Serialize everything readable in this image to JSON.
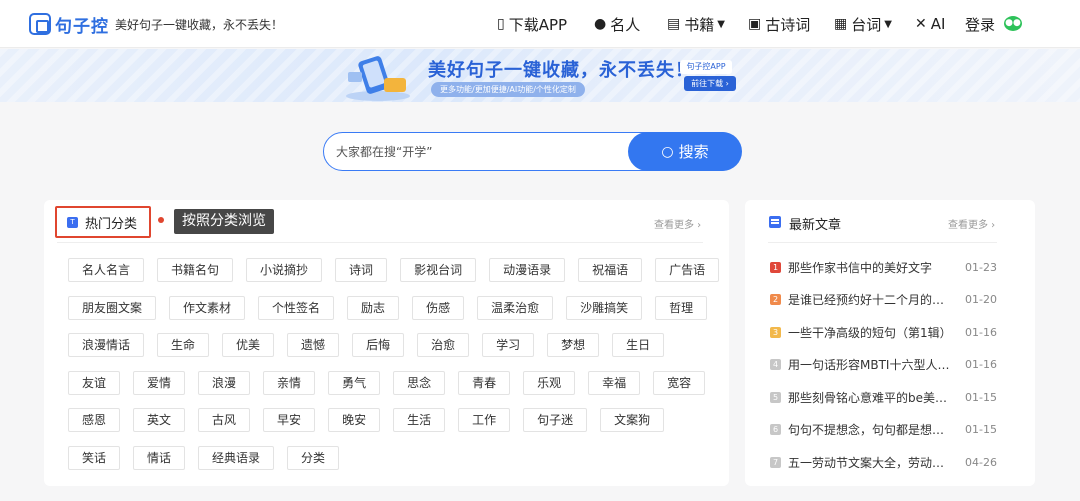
{
  "header": {
    "logo_name": "句子控",
    "slogan": "美好句子一键收藏，永不丢失！",
    "nav": [
      {
        "label": "下载APP",
        "icon": "phone-icon"
      },
      {
        "label": "名人",
        "icon": "person-icon"
      },
      {
        "label": "书籍",
        "icon": "book-icon",
        "dropdown": true
      },
      {
        "label": "古诗词",
        "icon": "scroll-icon"
      },
      {
        "label": "台词",
        "icon": "film-icon",
        "dropdown": true
      },
      {
        "label": "AI",
        "icon": "magic-wand-icon"
      }
    ],
    "login": "登录",
    "wechat_icon": "wechat-icon"
  },
  "banner": {
    "title": "美好句子一键收藏，永不丢失！",
    "subtitle": "更多功能/更加便捷/AI功能/个性化定制",
    "app_label": "句子控APP",
    "go_label": "前往下载"
  },
  "search": {
    "placeholder": "大家都在搜“开学”",
    "button_label": "搜索"
  },
  "categories": {
    "title": "热门分类",
    "tooltip": "按照分类浏览",
    "more": "查看更多",
    "rows": [
      [
        "名人名言",
        "书籍名句",
        "小说摘抄",
        "诗词",
        "影视台词",
        "动漫语录",
        "祝福语",
        "广告语"
      ],
      [
        "朋友圈文案",
        "作文素材",
        "个性签名",
        "励志",
        "伤感",
        "温柔治愈",
        "沙雕搞笑",
        "哲理"
      ],
      [
        "浪漫情话",
        "生命",
        "优美",
        "遗憾",
        "后悔",
        "治愈",
        "学习",
        "梦想",
        "生日"
      ],
      [
        "友谊",
        "爱情",
        "浪漫",
        "亲情",
        "勇气",
        "思念",
        "青春",
        "乐观",
        "幸福",
        "宽容"
      ],
      [
        "感恩",
        "英文",
        "古风",
        "早安",
        "晚安",
        "生活",
        "工作",
        "句子迷",
        "文案狗"
      ],
      [
        "笑话",
        "情话",
        "经典语录",
        "分类"
      ]
    ]
  },
  "articles": {
    "title": "最新文章",
    "more": "查看更多",
    "items": [
      {
        "num": "1",
        "title": "那些作家书信中的美好文字",
        "date": "01-23",
        "color": "#e0483a"
      },
      {
        "num": "2",
        "title": "是谁已经预约好十二个月的浪漫了",
        "date": "01-20",
        "color": "#f08a4b"
      },
      {
        "num": "3",
        "title": "一些干净高级的短句（第1辑）",
        "date": "01-16",
        "color": "#f2b84b"
      },
      {
        "num": "4",
        "title": "用一句话形容MBTI十六型人格的性格",
        "date": "01-16",
        "color": "#c7c7c7"
      },
      {
        "num": "5",
        "title": "那些刻骨铭心意难平的be美学文案",
        "date": "01-15",
        "color": "#c7c7c7"
      },
      {
        "num": "6",
        "title": "句句不提想念，句句都是想念一生",
        "date": "01-15",
        "color": "#c7c7c7"
      },
      {
        "num": "7",
        "title": "五一劳动节文案大全，劳动人民最光荣",
        "date": "04-26",
        "color": "#c7c7c7"
      }
    ]
  },
  "colors": {
    "brand": "#2f6fe0",
    "search_button": "#3377f0",
    "highlight_border": "#e0462f"
  }
}
